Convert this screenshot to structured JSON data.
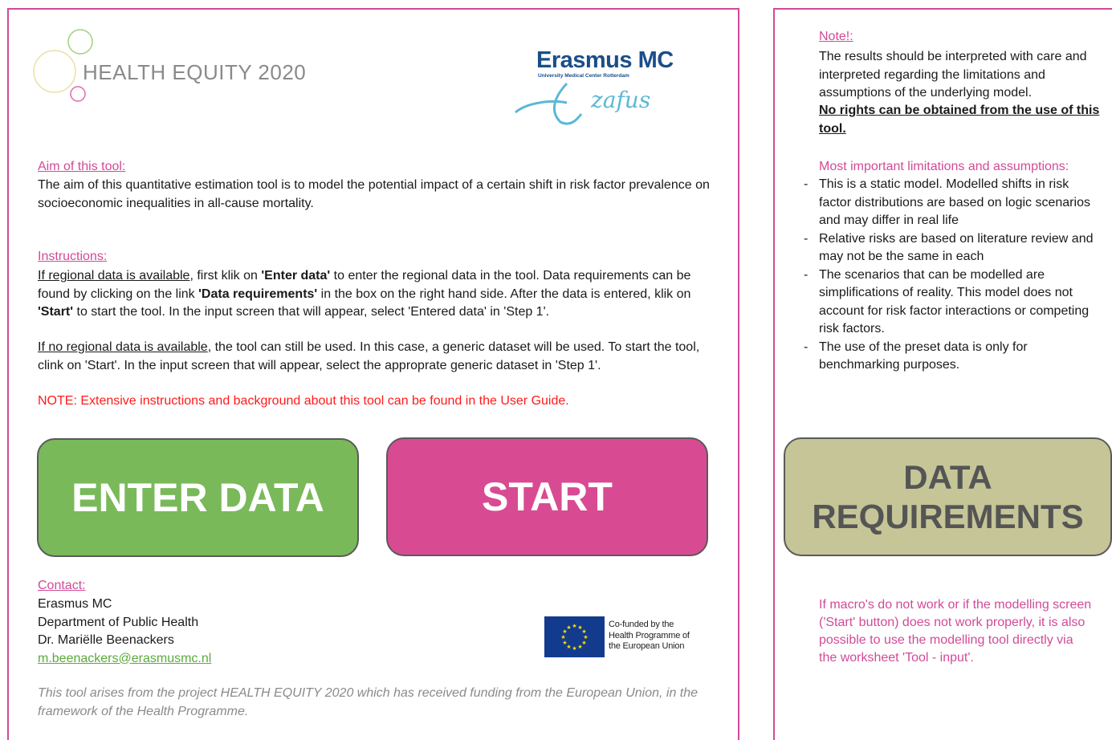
{
  "logos": {
    "health_equity": "HEALTH EQUITY 2020",
    "erasmus_name": "Erasmus MC",
    "erasmus_sub": "University Medical Center Rotterdam",
    "erasmus_script": "zafus"
  },
  "aim": {
    "heading": "Aim of this tool:",
    "text": "The aim of this quantitative estimation tool is to model the potential impact of a certain shift in risk factor prevalence on socioeconomic inequalities in all-cause mortality."
  },
  "instructions": {
    "heading": "Instructions:",
    "p1_link": "If regional data is available",
    "p1_a": ", first klik on ",
    "p1_b1": "'Enter data'",
    "p1_c": " to enter the regional data in the tool. Data requirements can be found by clicking on the link ",
    "p1_b2": "'Data requirements'",
    "p1_d": " in the box on the right hand side. After the data is entered, klik on ",
    "p1_b3": "'Start'",
    "p1_e": " to start the tool. In the input screen that will appear, select 'Entered data' in 'Step 1'.",
    "p2_link": "If no regional data is available",
    "p2_text": ", the tool can still be used. In this case, a generic dataset will be used. To start the tool, clink on 'Start'. In the input screen that will appear, select the approprate generic dataset in 'Step 1'.",
    "note": "NOTE: Extensive instructions and background about this tool can be found in the User Guide."
  },
  "buttons": {
    "enter_data": "ENTER DATA",
    "start": "START",
    "data_req_line1": "DATA",
    "data_req_line2": "REQUIREMENTS"
  },
  "contact": {
    "heading": "Contact:",
    "org": "Erasmus MC",
    "dept": "Department of Public Health",
    "person": "Dr. Mariëlle Beenackers",
    "email": "m.beenackers@erasmusmc.nl"
  },
  "eu": {
    "line1": "Co-funded by the",
    "line2": "Health Programme of",
    "line3": "the European Union"
  },
  "footer": {
    "text": "This tool arises from the project HEALTH EQUITY 2020 which has received funding from the European Union, in the framework of the Health Programme."
  },
  "note_panel": {
    "heading": "Note!:",
    "text": "The results should be interpreted with care and interpreted regarding the limitations and assumptions of the underlying model.",
    "bold": "No rights can be obtained from the use of this tool.",
    "lim_heading": "Most important limitations and assumptions:",
    "limitations": [
      "This is a static model. Modelled shifts in risk factor distributions are based on logic scenarios and may differ in real life",
      "Relative risks are based on literature review and may not be the same in each",
      "The scenarios that can be modelled are simplifications of reality. This model does not account for risk factor interactions or competing risk factors.",
      "The use of the preset data is only for benchmarking purposes."
    ],
    "macro_note": "If macro's do not work or if the modelling screen ('Start' button) does not work properly, it is also possible to use the modelling tool directly via the worksheet 'Tool - input'."
  },
  "colors": {
    "accent_pink": "#d24a97",
    "enter_green": "#79b95a",
    "start_pink": "#d84b93",
    "datareq_khaki": "#c6c597",
    "note_red": "#ff1a1a",
    "email_green": "#5aaa3c"
  }
}
